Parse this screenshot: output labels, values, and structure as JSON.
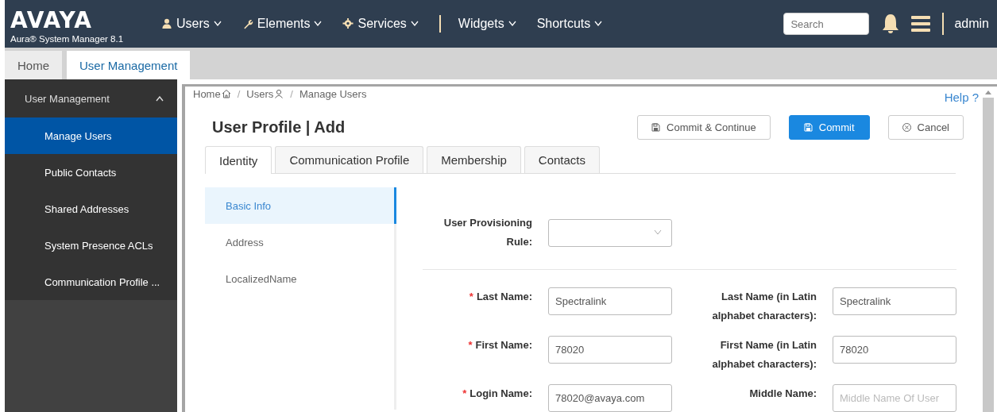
{
  "header": {
    "logo": "AVAYA",
    "product": "Aura® System Manager 8.1",
    "nav": [
      {
        "label": "Users"
      },
      {
        "label": "Elements"
      },
      {
        "label": "Services"
      },
      {
        "label": "Widgets"
      },
      {
        "label": "Shortcuts"
      }
    ],
    "search": {
      "placeholder": "Search"
    },
    "user": "admin"
  },
  "app_tabs": [
    {
      "label": "Home",
      "selected": false
    },
    {
      "label": "User Management",
      "selected": true
    }
  ],
  "sidebar": {
    "title": "User Management",
    "expanded": true,
    "items": [
      {
        "label": "Manage Users",
        "selected": true
      },
      {
        "label": "Public Contacts",
        "selected": false
      },
      {
        "label": "Shared Addresses",
        "selected": false
      },
      {
        "label": "System Presence ACLs",
        "selected": false
      },
      {
        "label": "Communication Profile ...",
        "selected": false
      }
    ]
  },
  "breadcrumb": [
    {
      "label": "Home"
    },
    {
      "separator": "/",
      "label": "Users"
    },
    {
      "separator": "/",
      "label": "Manage Users"
    }
  ],
  "help": "Help ?",
  "page_title": "User Profile | Add",
  "buttons": [
    {
      "label": "Commit & Continue",
      "kind": "secondary"
    },
    {
      "label": "Commit",
      "kind": "primary"
    },
    {
      "label": "Cancel",
      "kind": "cancel"
    }
  ],
  "tabs": [
    {
      "label": "Identity",
      "selected": true
    },
    {
      "label": "Communication Profile",
      "selected": false
    },
    {
      "label": "Membership",
      "selected": false
    },
    {
      "label": "Contacts",
      "selected": false
    }
  ],
  "sections": [
    {
      "label": "Basic Info",
      "selected": true
    },
    {
      "label": "Address",
      "selected": false
    },
    {
      "label": "LocalizedName",
      "selected": false
    }
  ],
  "provisioning": {
    "label": "User Provisioning Rule:",
    "kind": "select"
  },
  "form_rows": [
    {
      "left": {
        "required_mark": "*",
        "label": "Last Name:",
        "value": "Spectralink"
      },
      "right": {
        "label": "Last Name (in Latin alphabet characters):",
        "value": "Spectralink"
      }
    },
    {
      "left": {
        "required_mark": "*",
        "label": "First Name:",
        "value": "78020"
      },
      "right": {
        "label": "First Name (in Latin alphabet characters):",
        "value": "78020"
      }
    },
    {
      "left": {
        "required_mark": "*",
        "label": "Login Name:",
        "value": "78020@avaya.com"
      },
      "right": {
        "label": "Middle Name:",
        "placeholder": "Middle Name Of User"
      }
    }
  ]
}
